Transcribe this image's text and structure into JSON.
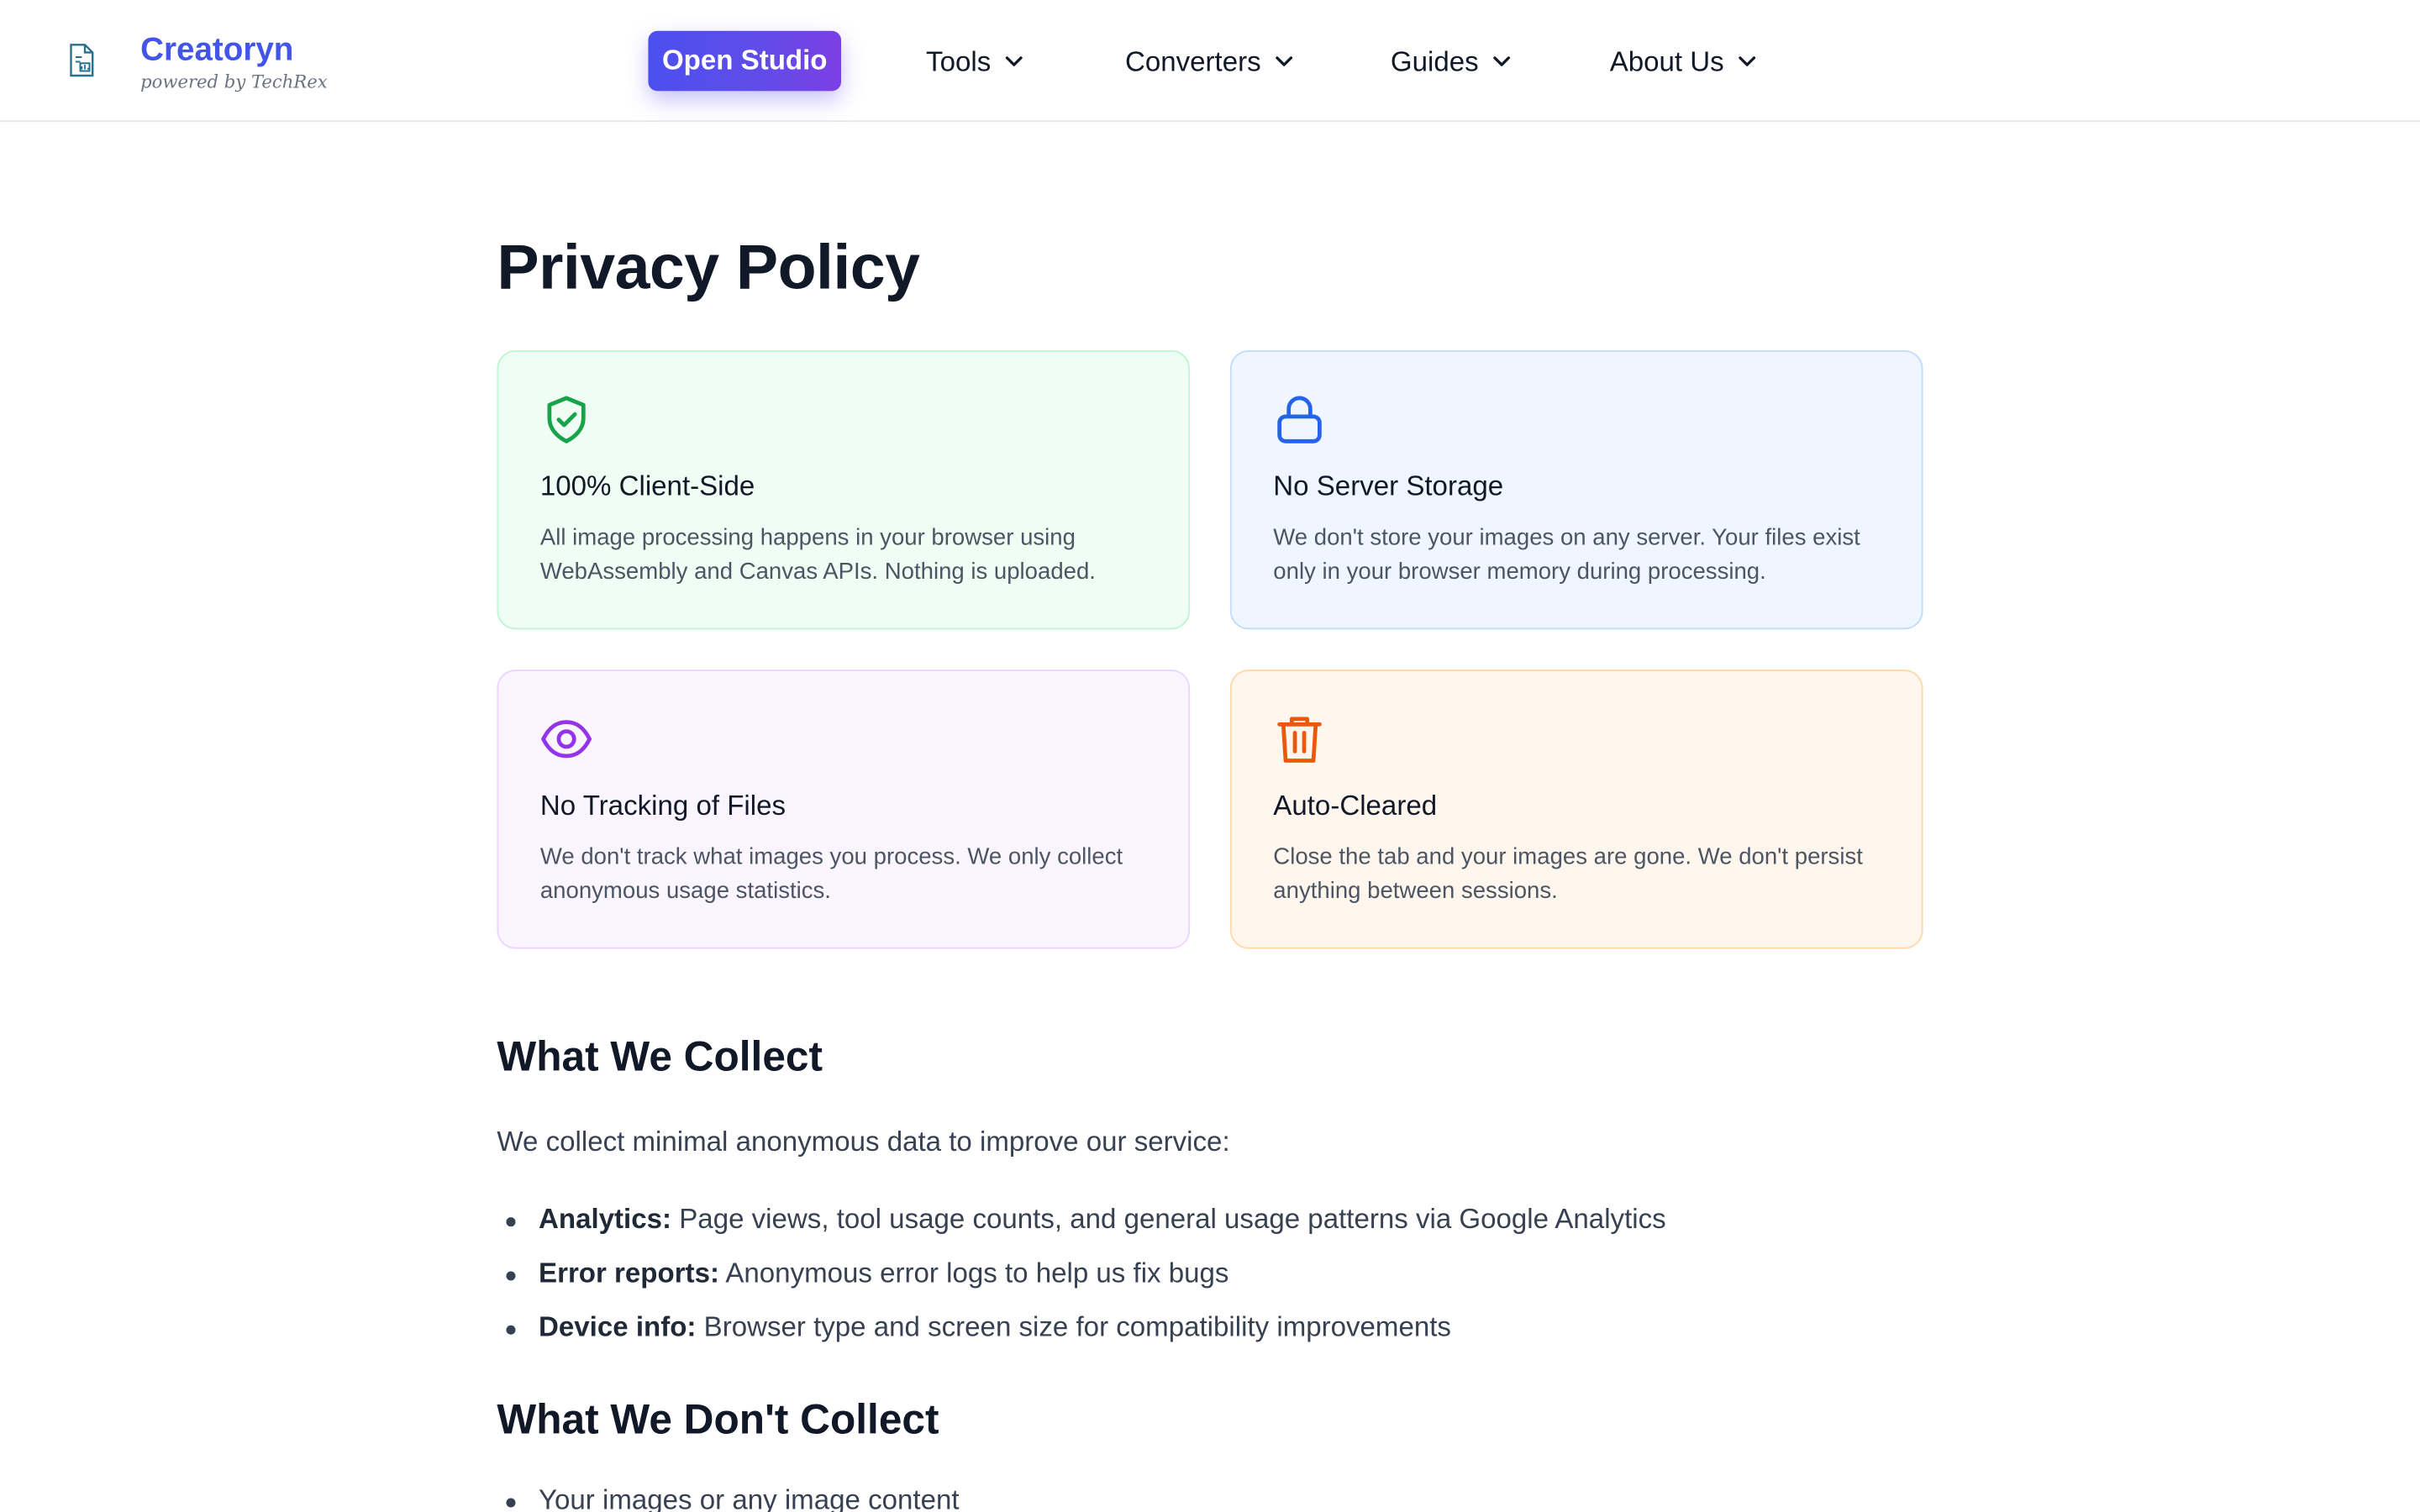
{
  "header": {
    "brand_name": "Creatoryn",
    "brand_sub": "powered by TechRex",
    "cta_label": "Open Studio",
    "nav": [
      {
        "label": "Tools"
      },
      {
        "label": "Converters"
      },
      {
        "label": "Guides"
      },
      {
        "label": "About Us"
      }
    ]
  },
  "page": {
    "title": "Privacy Policy"
  },
  "cards": [
    {
      "title": "100% Client-Side",
      "text": "All image processing happens in your browser using WebAssembly and Canvas APIs. Nothing is uploaded.",
      "icon": "shield-check-icon",
      "color": "#16a34a"
    },
    {
      "title": "No Server Storage",
      "text": "We don't store your images on any server. Your files exist only in your browser memory during processing.",
      "icon": "lock-icon",
      "color": "#2563eb"
    },
    {
      "title": "No Tracking of Files",
      "text": "We don't track what images you process. We only collect anonymous usage statistics.",
      "icon": "eye-icon",
      "color": "#9333ea"
    },
    {
      "title": "Auto-Cleared",
      "text": "Close the tab and your images are gone. We don't persist anything between sessions.",
      "icon": "trash-icon",
      "color": "#ea580c"
    }
  ],
  "collect": {
    "heading": "What We Collect",
    "lead": "We collect minimal anonymous data to improve our service:",
    "items": [
      {
        "label": "Analytics:",
        "text": "Page views, tool usage counts, and general usage patterns via Google Analytics"
      },
      {
        "label": "Error reports:",
        "text": "Anonymous error logs to help us fix bugs"
      },
      {
        "label": "Device info:",
        "text": "Browser type and screen size for compatibility improvements"
      }
    ]
  },
  "dont_collect": {
    "heading": "What We Don't Collect",
    "items": [
      {
        "text": "Your images or any image content"
      }
    ]
  }
}
